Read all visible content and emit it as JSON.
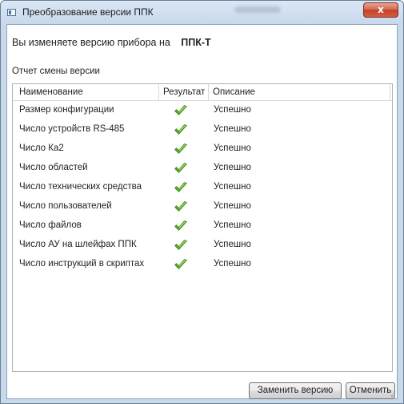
{
  "window": {
    "title": "Преобразование версии ППК",
    "close_glyph": "x"
  },
  "main": {
    "version_prefix": "Вы изменяете версию прибора на",
    "version_value": "ППК-Т",
    "report_label": "Отчет смены версии"
  },
  "table": {
    "columns": [
      "Наименование",
      "Результат",
      "Описание"
    ],
    "rows": [
      {
        "name": "Размер конфигурации",
        "result": "check-icon",
        "description": "Успешно"
      },
      {
        "name": "Число устройств RS-485",
        "result": "check-icon",
        "description": "Успешно"
      },
      {
        "name": "Число Ка2",
        "result": "check-icon",
        "description": "Успешно"
      },
      {
        "name": "Число областей",
        "result": "check-icon",
        "description": "Успешно"
      },
      {
        "name": "Число технических средства",
        "result": "check-icon",
        "description": "Успешно"
      },
      {
        "name": "Число пользователей",
        "result": "check-icon",
        "description": "Успешно"
      },
      {
        "name": "Число файлов",
        "result": "check-icon",
        "description": "Успешно"
      },
      {
        "name": "Число АУ на шлейфах ППК",
        "result": "check-icon",
        "description": "Успешно"
      },
      {
        "name": "Число инструкций в скриптах",
        "result": "check-icon",
        "description": "Успешно"
      }
    ]
  },
  "buttons": {
    "replace_label": "Заменить версию",
    "cancel_label": "Отменить"
  },
  "colors": {
    "check_green": "#5aa51e",
    "close_red": "#c2412a",
    "title_gradient": "#c8d9ec"
  }
}
